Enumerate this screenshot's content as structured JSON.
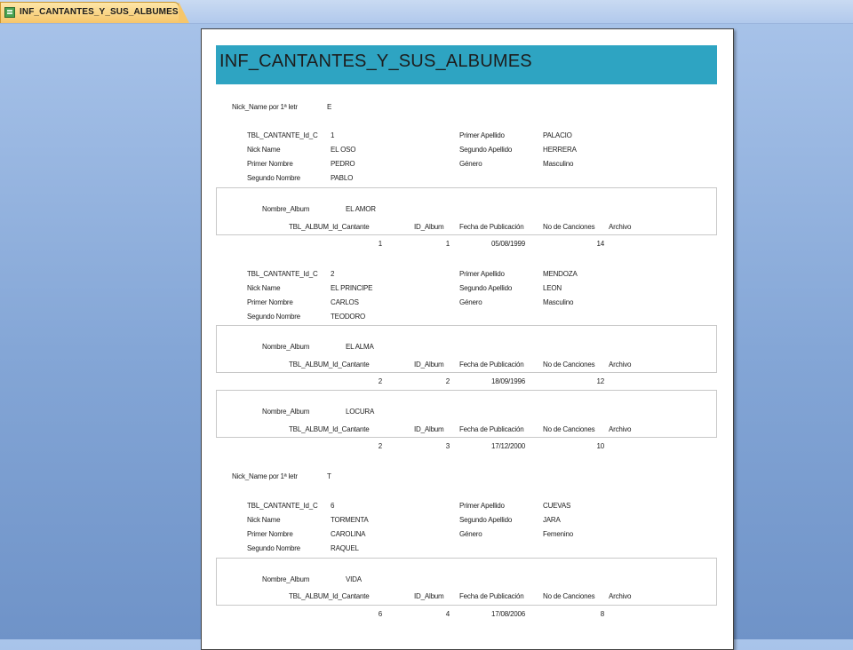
{
  "tab": {
    "label": "INF_CANTANTES_Y_SUS_ALBUMES"
  },
  "report": {
    "title": "INF_CANTANTES_Y_SUS_ALBUMES",
    "labels": {
      "group": "Nick_Name por 1ª letr",
      "id": "TBL_CANTANTE_Id_C",
      "nick": "Nick Name",
      "first": "Primer Nombre",
      "second": "Segundo Nombre",
      "last1": "Primer Apellido",
      "last2": "Segundo Apellido",
      "gender": "Género",
      "album_name": "Nombre_Album",
      "col_singer": "TBL_ALBUM_Id_Cantante",
      "col_id": "ID_Album",
      "col_date": "Fecha de Publicación",
      "col_songs": "No de Canciones",
      "col_file": "Archivo"
    },
    "groups": [
      {
        "letter": "E",
        "singers": [
          {
            "id": "1",
            "nick": "EL OSO",
            "first": "PEDRO",
            "second": "PABLO",
            "last1": "PALACIO",
            "last2": "HERRERA",
            "gender": "Masculino",
            "albums": [
              {
                "name": "EL AMOR",
                "singer_id": "1",
                "album_id": "1",
                "date": "05/08/1999",
                "songs": "14"
              }
            ]
          },
          {
            "id": "2",
            "nick": "EL PRINCIPE",
            "first": "CARLOS",
            "second": "TEODORO",
            "last1": "MENDOZA",
            "last2": "LEON",
            "gender": "Masculino",
            "albums": [
              {
                "name": "EL ALMA",
                "singer_id": "2",
                "album_id": "2",
                "date": "18/09/1996",
                "songs": "12"
              },
              {
                "name": "LOCURA",
                "singer_id": "2",
                "album_id": "3",
                "date": "17/12/2000",
                "songs": "10"
              }
            ]
          }
        ]
      },
      {
        "letter": "T",
        "singers": [
          {
            "id": "6",
            "nick": "TORMENTA",
            "first": "CAROLINA",
            "second": "RAQUEL",
            "last1": "CUEVAS",
            "last2": "JARA",
            "gender": "Femenino",
            "albums": [
              {
                "name": "VIDA",
                "singer_id": "6",
                "album_id": "4",
                "date": "17/08/2006",
                "songs": "8"
              }
            ]
          }
        ]
      }
    ]
  }
}
